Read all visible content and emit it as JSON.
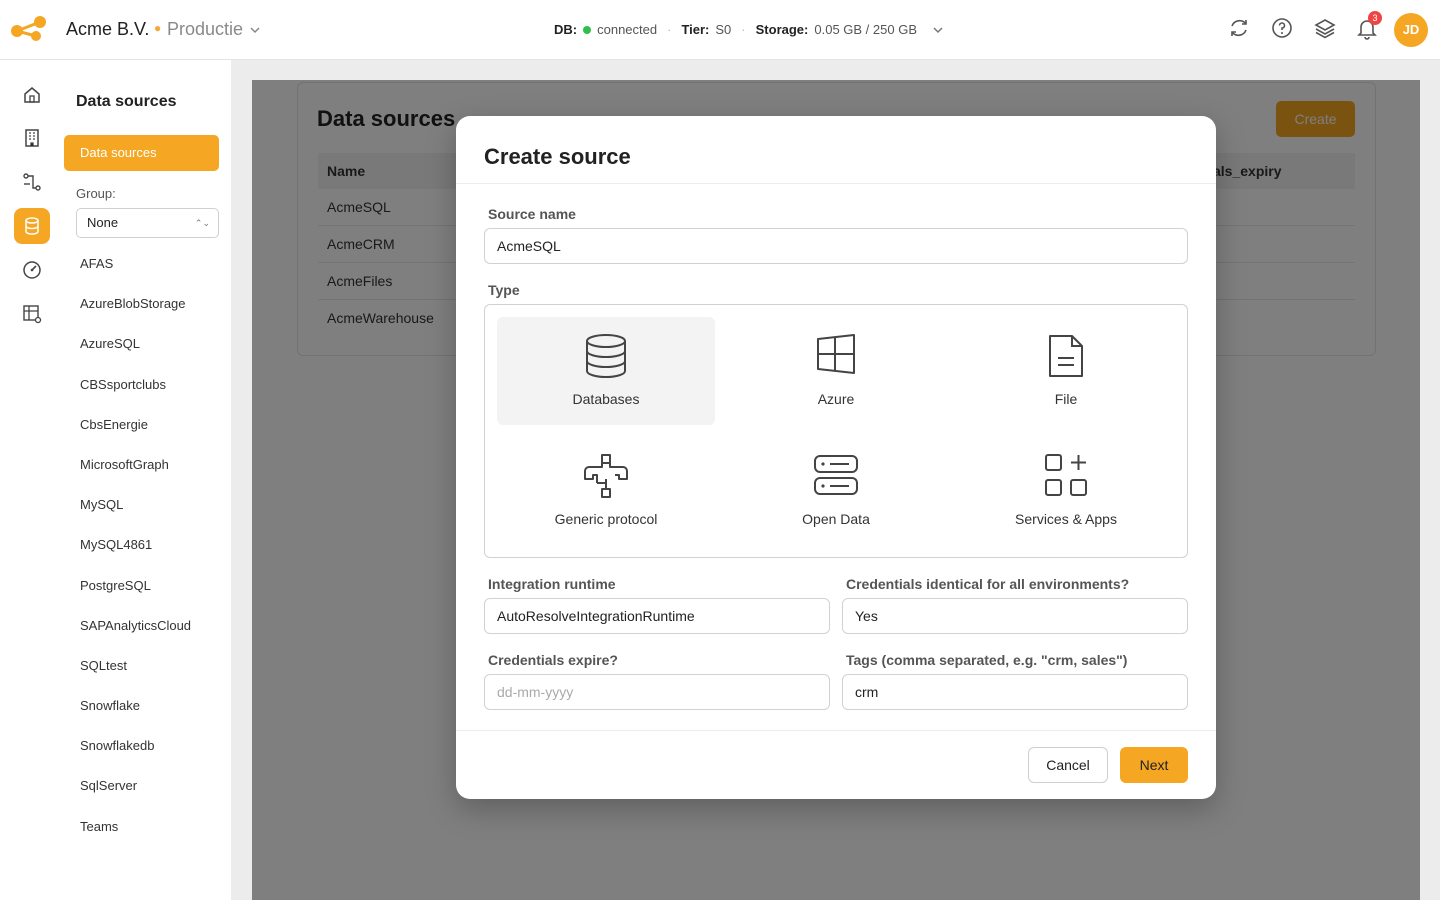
{
  "header": {
    "company": "Acme B.V.",
    "environment": "Productie",
    "db_label": "DB:",
    "db_status": "connected",
    "tier_label": "Tier:",
    "tier_value": "S0",
    "storage_label": "Storage:",
    "storage_value": "0.05 GB / 250 GB",
    "notifications_count": "3",
    "avatar_initials": "JD"
  },
  "sidebar": {
    "title": "Data sources",
    "active_item": "Data sources",
    "group_label": "Group:",
    "group_value": "None",
    "items": [
      "AFAS",
      "AzureBlobStorage",
      "AzureSQL",
      "CBSsportclubs",
      "CbsEnergie",
      "MicrosoftGraph",
      "MySQL",
      "MySQL4861",
      "PostgreSQL",
      "SAPAnalyticsCloud",
      "SQLtest",
      "Snowflake",
      "Snowflakedb",
      "SqlServer",
      "Teams"
    ]
  },
  "main": {
    "title": "Data sources",
    "create_label": "Create",
    "columns": [
      "Name",
      "als_expiry"
    ],
    "rows": [
      "AcmeSQL",
      "AcmeCRM",
      "AcmeFiles",
      "AcmeWarehouse"
    ]
  },
  "modal": {
    "title": "Create source",
    "source_name_label": "Source name",
    "source_name_value": "AcmeSQL",
    "type_label": "Type",
    "types": [
      "Databases",
      "Azure",
      "File",
      "Generic protocol",
      "Open Data",
      "Services & Apps"
    ],
    "selected_type": "Databases",
    "runtime_label": "Integration runtime",
    "runtime_value": "AutoResolveIntegrationRuntime",
    "credentials_identical_label": "Credentials identical for all environments?",
    "credentials_identical_value": "Yes",
    "credentials_expire_label": "Credentials expire?",
    "credentials_expire_placeholder": "dd-mm-yyyy",
    "tags_label": "Tags (comma separated, e.g. \"crm, sales\")",
    "tags_value": "crm",
    "cancel_label": "Cancel",
    "next_label": "Next"
  },
  "colors": {
    "accent": "#f5a623",
    "status_green": "#2fbf4a",
    "badge_red": "#ef4444"
  }
}
